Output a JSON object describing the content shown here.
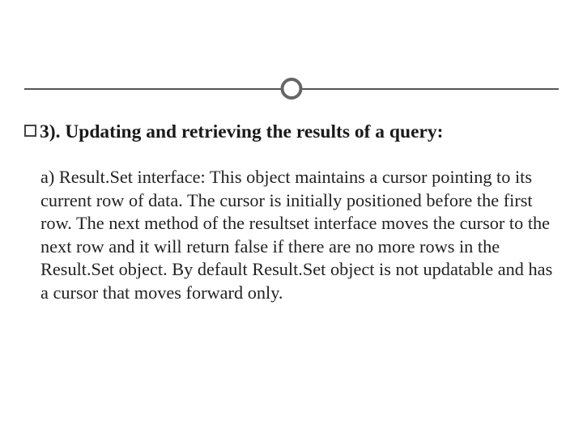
{
  "slide": {
    "heading": "3). Updating and retrieving the results of a query:",
    "body": "a) Result.Set interface: This object maintains a cursor pointing to its current row of data. The cursor is initially positioned before the first row. The next method of the resultset interface moves the cursor to the next row and it will return false if there are no more rows in the Result.Set object. By default Result.Set object is not updatable and has a cursor that moves forward only."
  }
}
